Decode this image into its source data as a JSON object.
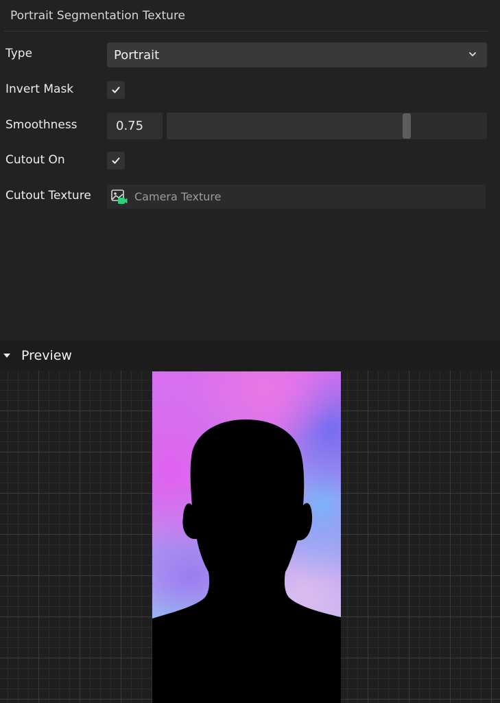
{
  "panel": {
    "title": "Portrait Segmentation Texture"
  },
  "properties": {
    "type": {
      "label": "Type",
      "value": "Portrait"
    },
    "invert_mask": {
      "label": "Invert Mask",
      "checked": true
    },
    "smoothness": {
      "label": "Smoothness",
      "value": "0.75",
      "slider_fraction": 0.75
    },
    "cutout_on": {
      "label": "Cutout On",
      "checked": true
    },
    "cutout_texture": {
      "label": "Cutout Texture",
      "value": "Camera Texture",
      "icon": "camera-texture-icon"
    }
  },
  "preview": {
    "title": "Preview",
    "expanded": true
  },
  "colors": {
    "accent_green": "#2fd07a",
    "panel_bg": "#222222",
    "field_bg": "#393939"
  }
}
